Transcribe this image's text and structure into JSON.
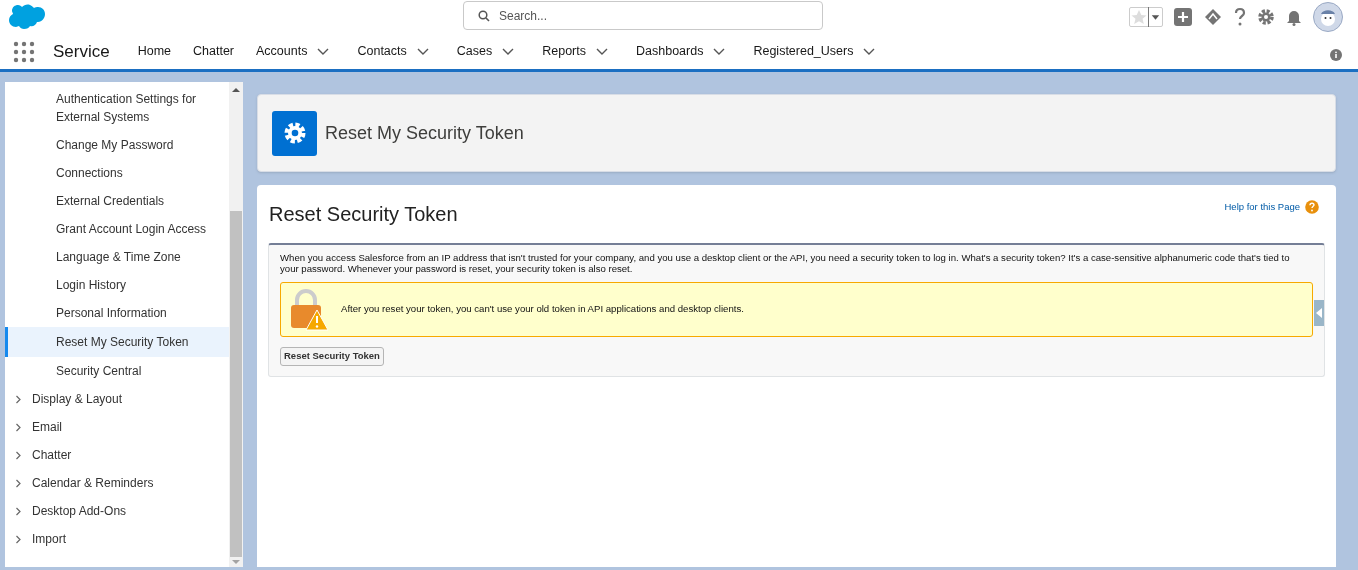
{
  "header": {
    "search": {
      "placeholder": "Search..."
    }
  },
  "nav": {
    "app_name": "Service",
    "items": [
      {
        "label": "Home",
        "has_menu": false
      },
      {
        "label": "Chatter",
        "has_menu": false
      },
      {
        "label": "Accounts",
        "has_menu": true
      },
      {
        "label": "Contacts",
        "has_menu": true
      },
      {
        "label": "Cases",
        "has_menu": true
      },
      {
        "label": "Reports",
        "has_menu": true
      },
      {
        "label": "Dashboards",
        "has_menu": true
      },
      {
        "label": "Registered_Users",
        "has_menu": true
      }
    ]
  },
  "sidebar": {
    "sub_items": [
      {
        "label": "Authentication Settings for External Systems",
        "selected": false
      },
      {
        "label": "Change My Password",
        "selected": false
      },
      {
        "label": "Connections",
        "selected": false
      },
      {
        "label": "External Credentials",
        "selected": false
      },
      {
        "label": "Grant Account Login Access",
        "selected": false
      },
      {
        "label": "Language & Time Zone",
        "selected": false
      },
      {
        "label": "Login History",
        "selected": false
      },
      {
        "label": "Personal Information",
        "selected": false
      },
      {
        "label": "Reset My Security Token",
        "selected": true
      },
      {
        "label": "Security Central",
        "selected": false
      }
    ],
    "sections": [
      {
        "label": "Display & Layout",
        "expanded": false
      },
      {
        "label": "Email",
        "expanded": false
      },
      {
        "label": "Chatter",
        "expanded": false
      },
      {
        "label": "Calendar & Reminders",
        "expanded": false
      },
      {
        "label": "Desktop Add-Ons",
        "expanded": false
      },
      {
        "label": "Import",
        "expanded": false
      }
    ]
  },
  "page_header": {
    "title": "Reset My Security Token"
  },
  "content": {
    "title": "Reset Security Token",
    "help_link": "Help for this Page",
    "description": "When you access Salesforce from an IP address that isn't trusted for your company, and you use a desktop client or the API, you need a security token to log in. What's a security token? It's a case-sensitive alphanumeric code that's tied to your password. Whenever your password is reset, your security token is also reset.",
    "warning": "After you reset your token, you can't use your old token in API applications and desktop clients.",
    "button": "Reset Security Token"
  }
}
